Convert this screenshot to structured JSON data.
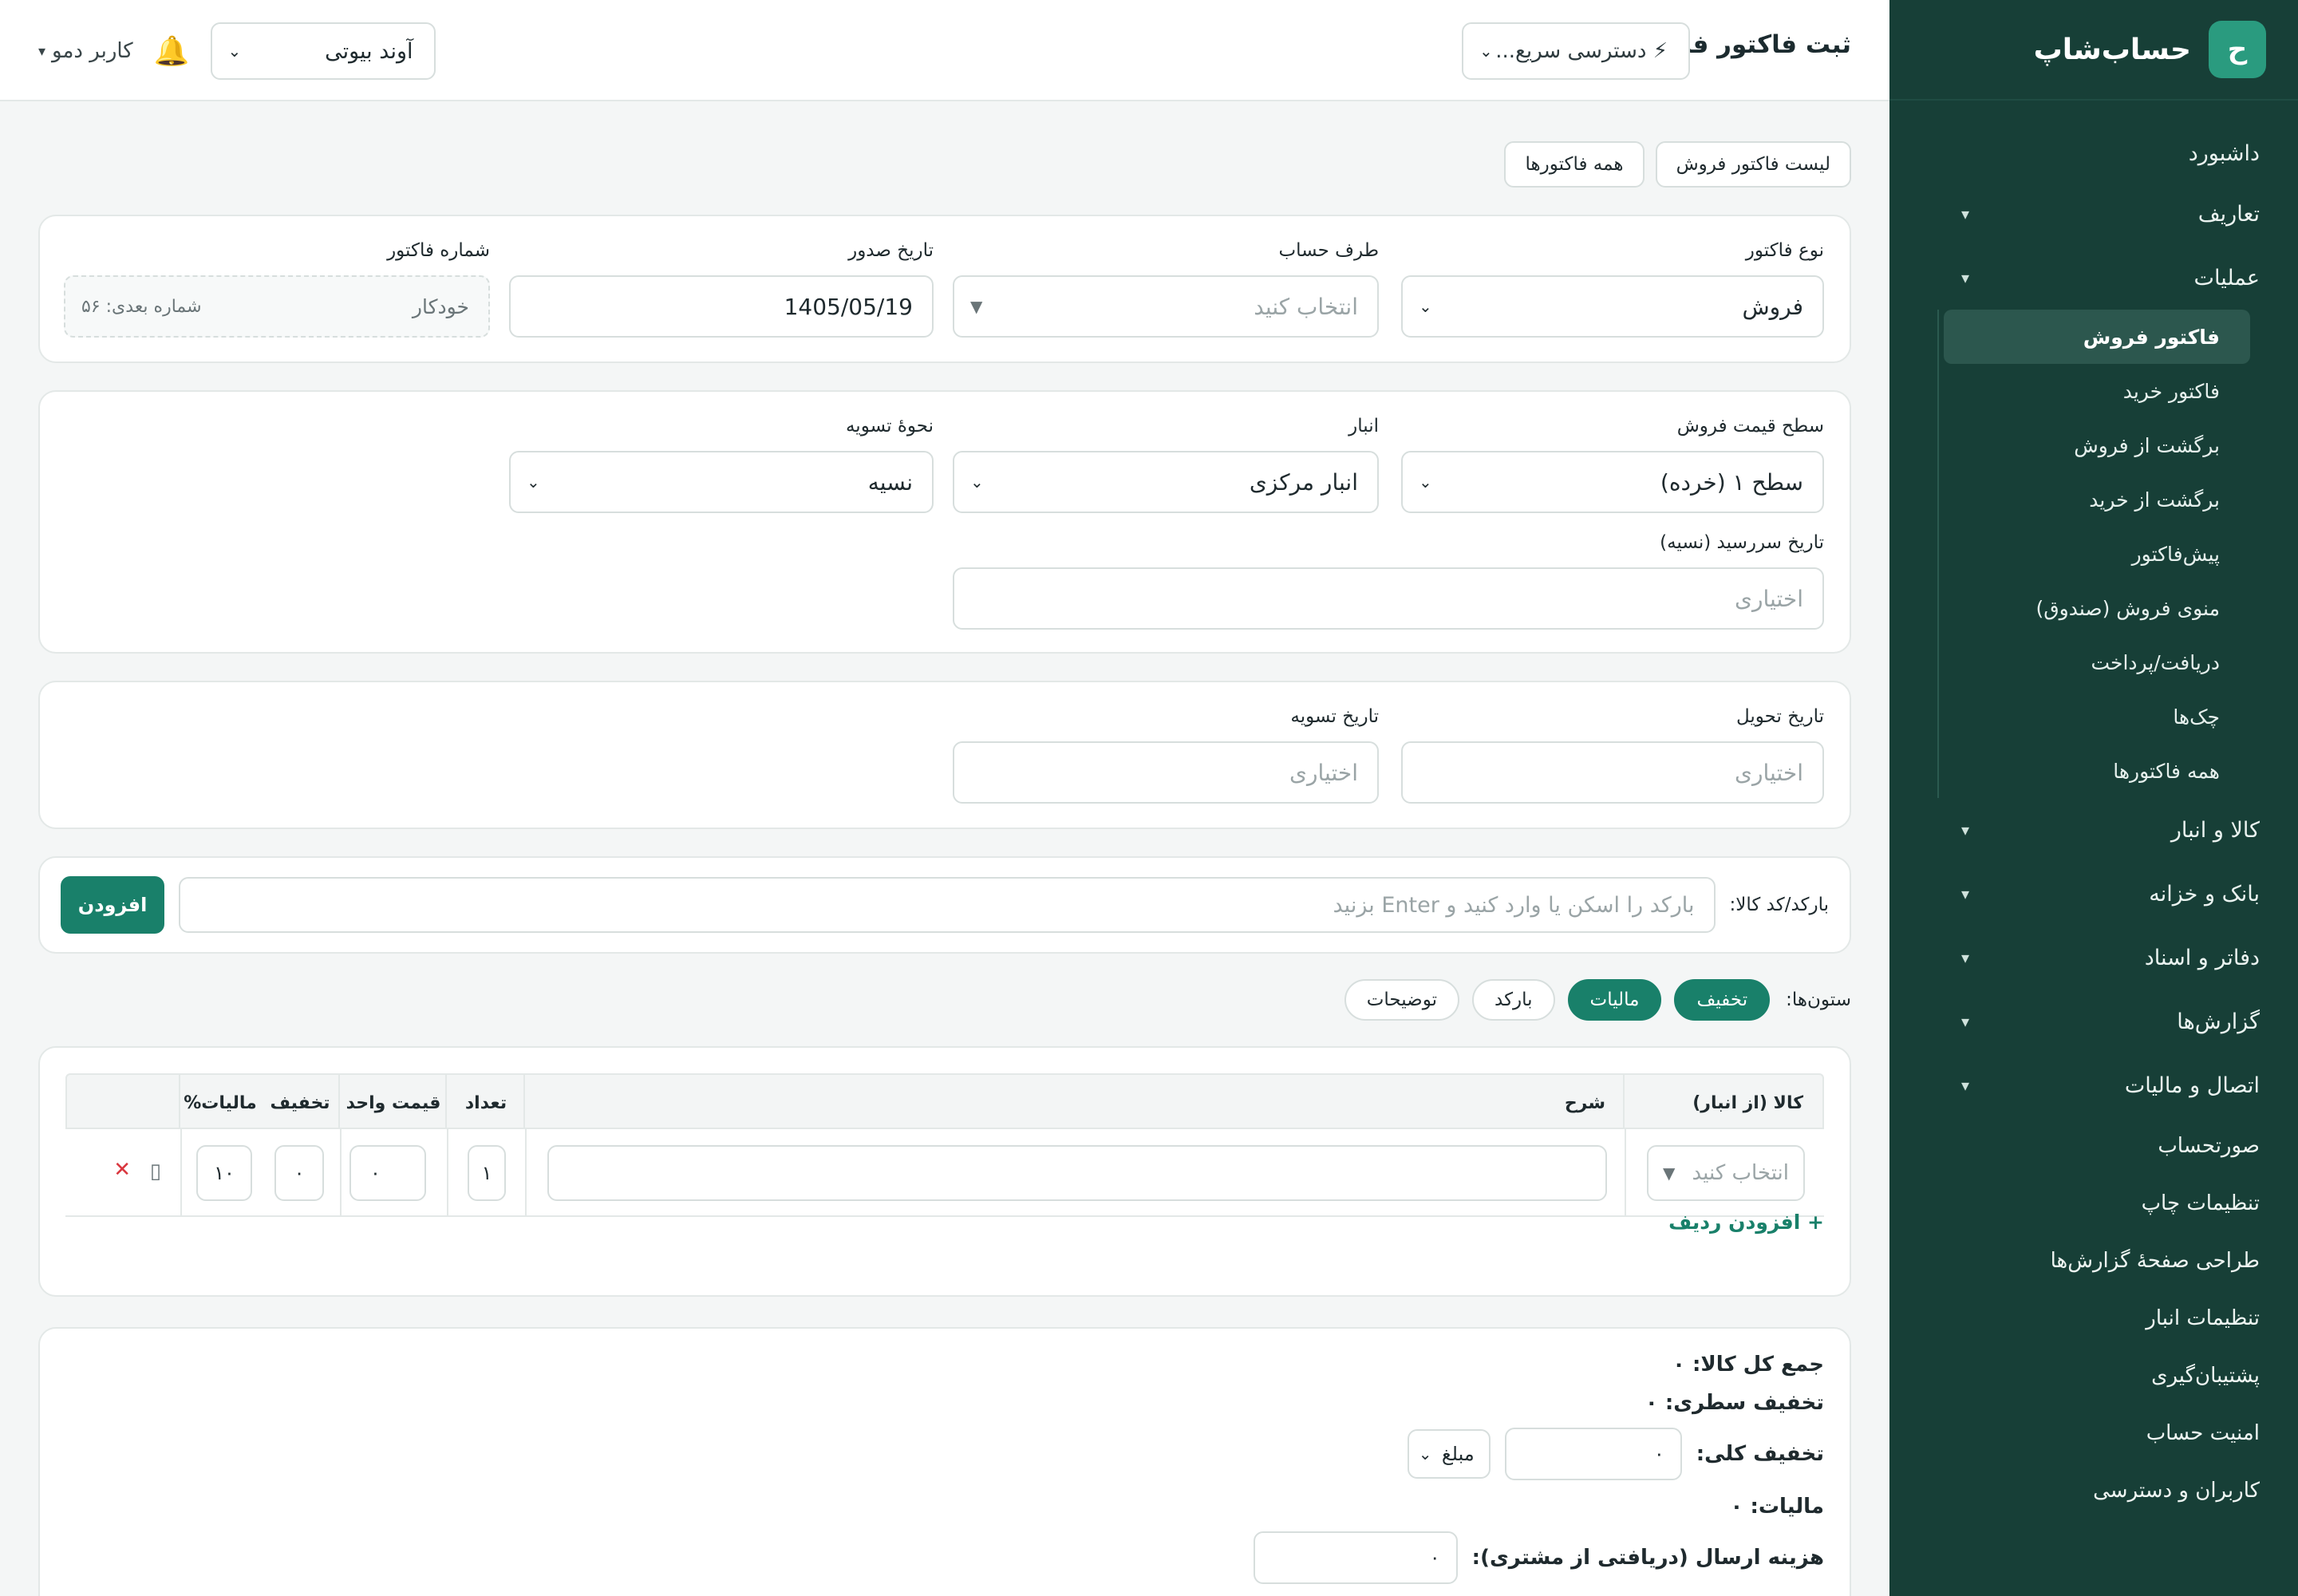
{
  "brand": {
    "logo_letter": "ح",
    "name": "حساب‌شاپ"
  },
  "sidebar": {
    "dashboard": "داشبورد",
    "groups": [
      {
        "label": "تعاریف",
        "chevron": "▾"
      },
      {
        "label": "عملیات",
        "chevron": "▾"
      }
    ],
    "operations_items": [
      "فاکتور فروش",
      "فاکتور خرید",
      "برگشت از فروش",
      "برگشت از خرید",
      "پیش‌فاکتور",
      "منوی فروش (صندوق)",
      "دریافت/پرداخت",
      "چک‌ها",
      "همه فاکتورها"
    ],
    "more_groups": [
      {
        "label": "کالا و انبار",
        "chevron": "▾"
      },
      {
        "label": "بانک و خزانه",
        "chevron": "▾"
      },
      {
        "label": "دفاتر و اسناد",
        "chevron": "▾"
      },
      {
        "label": "گزارش‌ها",
        "chevron": "▾"
      },
      {
        "label": "اتصال و مالیات",
        "chevron": "▾"
      }
    ],
    "plain_items": [
      "صورتحساب",
      "تنظیمات چاپ",
      "طراحی صفحهٔ گزارش‌ها",
      "تنظیمات انبار",
      "پشتیبان‌گیری",
      "امنیت حساب",
      "کاربران و دسترسی"
    ]
  },
  "header": {
    "title": "ثبت فاکتور فروش",
    "quick_access": "⚡ دسترسی سریع...",
    "company": "آوند بیوتی",
    "user": "کاربر دمو",
    "user_caret": "▾"
  },
  "top_links": {
    "all_invoices": "همه فاکتورها",
    "sales_list": "لیست فاکتور فروش"
  },
  "basic": {
    "type_label": "نوع فاکتور",
    "type_value": "فروش",
    "party_label": "طرف حساب",
    "party_placeholder": "انتخاب کنید",
    "date_label": "تاریخ صدور",
    "date_value": "1405/05/19",
    "number_label": "شماره فاکتور",
    "number_value": "خودکار",
    "number_next": "شماره بعدی: ۵۶"
  },
  "pricing": {
    "level_label": "سطح قیمت فروش",
    "level_value": "سطح ۱ (خرده)",
    "warehouse_label": "انبار",
    "warehouse_value": "انبار مرکزی",
    "settle_label": "نحوهٔ تسویه",
    "settle_value": "نسیه",
    "due_label": "تاریخ سررسید (نسیه)",
    "due_placeholder": "اختیاری"
  },
  "dates": {
    "delivery_label": "تاریخ تحویل",
    "delivery_placeholder": "اختیاری",
    "settle_date_label": "تاریخ تسویه",
    "settle_date_placeholder": "اختیاری"
  },
  "barcode": {
    "label": "بارکد/کد کالا:",
    "placeholder": "بارکد را اسکن یا وارد کنید و Enter بزنید",
    "add": "افزودن"
  },
  "columns": {
    "label": "ستون‌ها:",
    "chips": [
      {
        "label": "تخفیف",
        "on": true
      },
      {
        "label": "مالیات",
        "on": true
      },
      {
        "label": "بارکد",
        "on": false
      },
      {
        "label": "توضیحات",
        "on": false
      }
    ]
  },
  "table": {
    "headers": {
      "product": "کالا (از انبار)",
      "desc": "شرح",
      "qty": "تعداد",
      "unit_price": "قیمت واحد",
      "discount": "تخفیف",
      "tax": "مالیات%"
    },
    "rows": [
      {
        "product_placeholder": "انتخاب کنید",
        "desc": "",
        "qty": "۱",
        "unit_price": "۰",
        "discount": "۰",
        "tax": "۱۰",
        "delete": "✕",
        "copy": "▯"
      }
    ],
    "add_row": "+ افزودن ردیف"
  },
  "totals": {
    "items_total": "جمع کل کالا: ۰",
    "line_discount": "تخفیف سطری: ۰",
    "overall_discount_label": "تخفیف کلی:",
    "overall_discount_value": "۰",
    "discount_mode": "مبلغ",
    "tax": "مالیات: ۰",
    "shipping_label": "هزینه ارسال (دریافتی از مشتری):",
    "shipping_value": "۰"
  }
}
